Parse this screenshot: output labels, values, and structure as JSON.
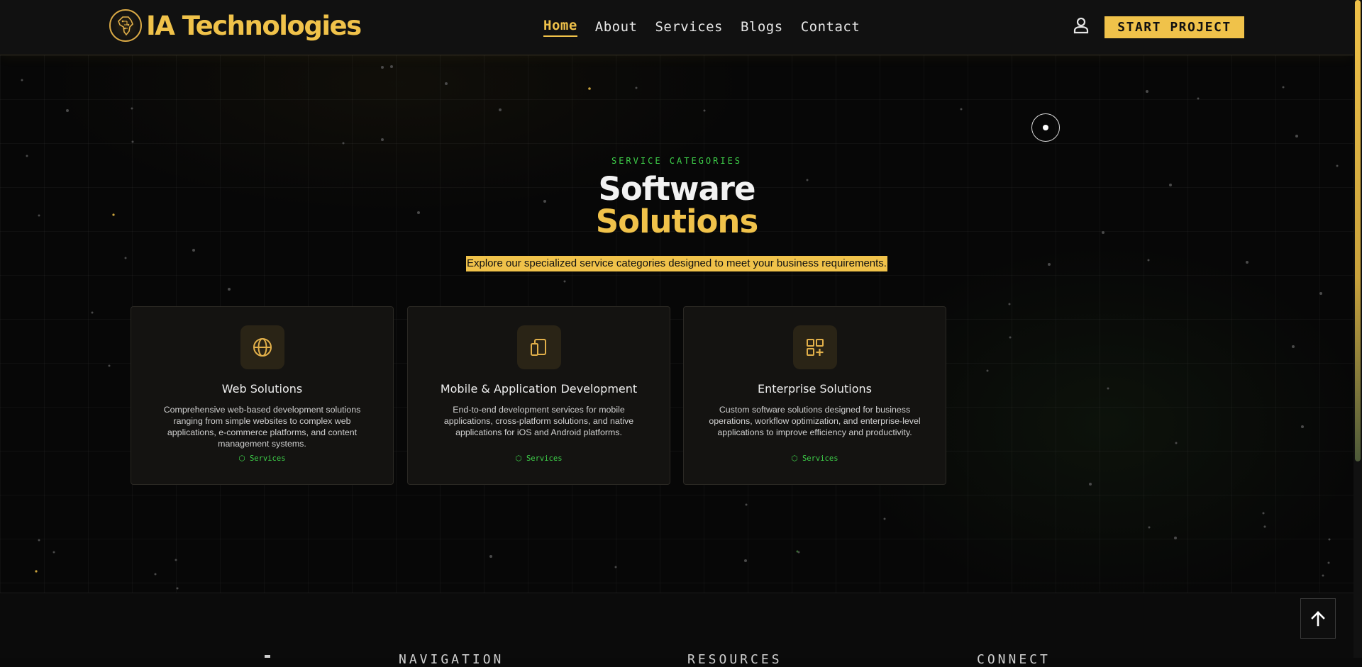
{
  "navbar": {
    "brand": "IA Technologies",
    "links": [
      "Home",
      "About",
      "Services",
      "Blogs",
      "Contact"
    ],
    "active_link": "Home",
    "cta_label": "START PROJECT",
    "user_icon": "user-icon"
  },
  "hero": {
    "eyebrow": "SERVICE CATEGORIES",
    "title_line1": "Software",
    "title_line2": "Solutions",
    "subtitle": "Explore our specialized service categories designed to meet your business requirements."
  },
  "cards": [
    {
      "icon": "globe-icon",
      "title": "Web Solutions",
      "description": "Comprehensive web-based development solutions ranging from simple websites to complex web applications, e-commerce platforms, and content management systems.",
      "tag": "Services",
      "tag_icon": "cube-icon"
    },
    {
      "icon": "devices-icon",
      "title": "Mobile & Application Development",
      "description": "End-to-end development services for mobile applications, cross-platform solutions, and native applications for iOS and Android platforms.",
      "tag": "Services",
      "tag_icon": "cube-icon"
    },
    {
      "icon": "apps-add-icon",
      "title": "Enterprise Solutions",
      "description": "Custom software solutions designed for business operations, workflow optimization, and enterprise-level applications to improve efficiency and productivity.",
      "tag": "Services",
      "tag_icon": "cube-icon"
    }
  ],
  "footer": {
    "headings": [
      "NAVIGATION",
      "RESOURCES",
      "CONNECT"
    ]
  },
  "colors": {
    "accent": "#f0c24a",
    "green": "#3ed14a",
    "background": "#070707",
    "navbar": "#111111"
  }
}
